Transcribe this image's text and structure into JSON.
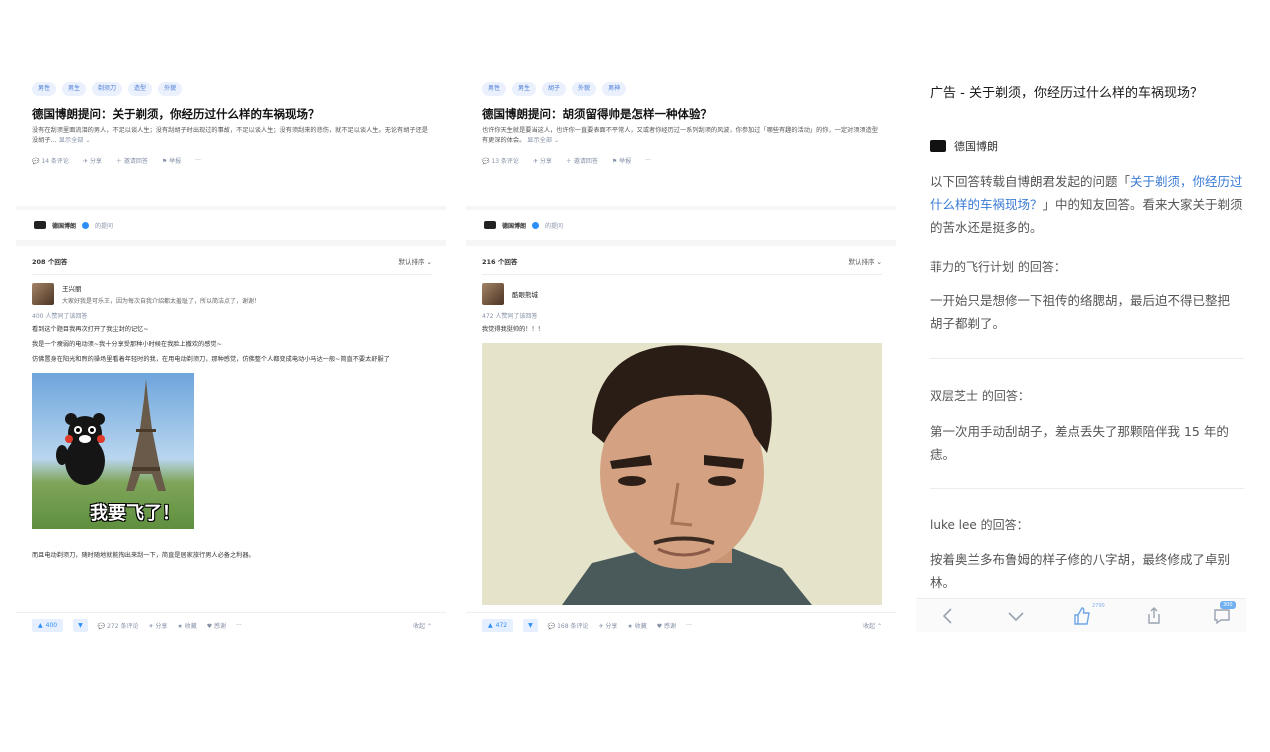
{
  "panel1": {
    "tags": [
      "男性",
      "男生",
      "剃须刀",
      "造型",
      "外貌"
    ],
    "question_title": "德国博朗提问：关于剃须，你经历过什么样的车祸现场？",
    "question_desc": "没有在刮须里面流泪的男人，不足以谈人生；没有刮胡子时出现过的事故，不足以谈人生；没有须刮来的悲伤，就不足以谈人生。无论有胡子还是没胡子…",
    "more_label": "显示全部 ⌄",
    "actions": {
      "comments": "14 条评论",
      "share": "分享",
      "invite": "邀请回答",
      "report": "举报",
      "more": "···"
    },
    "author": {
      "name": "德国博朗",
      "follow": "的提问"
    },
    "answers_count": "208 个回答",
    "sort_label": "默认排序 ⌄",
    "answer": {
      "user": "王兴丽",
      "bio": "大家好我是可乐王，因为每次自我介绍都太羞耻了，所以简洁点了，谢谢！",
      "likes": "400 人赞同了该回答",
      "para1": "看到这个题目我再次打开了我尘封的记忆~",
      "para2": "我是一个瘦弱的电动须~我十分享受那种小时候在我脸上撒欢的感觉~",
      "para3": "仿佛置身在阳光和煦的操场里看着年轻时的我，在用电动剃须刀，那种感觉，仿佛整个人都变成电动小马达一般~简直不要太舒服了",
      "meme_caption": "我要飞了！",
      "para4": "而且电动剃须刀，随时随地就能掏出来刮一下，简直是居家旅行男人必备之利器。"
    },
    "bottom": {
      "vote": "400",
      "comments": "272 条评论",
      "share": "分享",
      "collect": "收藏",
      "thanks": "感谢",
      "more": "···",
      "collapse": "收起 ⌃"
    }
  },
  "panel2": {
    "tags": [
      "男性",
      "男生",
      "胡子",
      "外貌",
      "男神"
    ],
    "question_title": "德国博朗提问：胡须留得帅是怎样一种体验？",
    "question_desc": "也许你天生就是要当这人，也许你一直要表面不平常人，又或者你经历过一系列刮须的风波，你参加过「哪些有趣的活动」的你，一定对须须造型有更深的体会。",
    "more_label": "显示全部 ⌄",
    "actions": {
      "comments": "13 条评论",
      "share": "分享",
      "invite": "邀请回答",
      "report": "举报",
      "more": "···"
    },
    "author": {
      "name": "德国博朗",
      "follow": "的提问"
    },
    "answers_count": "216 个回答",
    "sort_label": "默认排序 ⌄",
    "answer": {
      "user": "酷眼熊城",
      "likes": "472 人赞同了该回答",
      "para1": "我觉得我挺帅的！！！"
    },
    "bottom": {
      "vote": "472",
      "comments": "168 条评论",
      "share": "分享",
      "collect": "收藏",
      "thanks": "感谢",
      "more": "···",
      "collapse": "收起 ⌃"
    }
  },
  "panel3": {
    "ad_title": "广告 - 关于剃须，你经历过什么样的车祸现场？",
    "author": "德国博朗",
    "intro_before": "以下回答转载自博朗君发起的问题「",
    "intro_link": "关于剃须，你经历过什么样的车祸现场？",
    "intro_after": "」中的知友回答。看来大家关于剃须的苦水还是挺多的。",
    "responses": [
      {
        "label": "菲力的飞行计划 的回答：",
        "text": "一开始只是想修一下祖传的络腮胡，最后迫不得已整把胡子都剃了。"
      },
      {
        "label": "双层芝士 的回答：",
        "text": "第一次用手动刮胡子，差点丢失了那颗陪伴我 15 年的痣。"
      },
      {
        "label": "luke lee 的回答：",
        "text": "按着奥兰多布鲁姆的样子修的八字胡，最终修成了卓别林。"
      }
    ],
    "toolbar": {
      "like_count": "2790",
      "comment_count": "300"
    }
  },
  "colors": {
    "accent": "#2c8ef8",
    "tag_bg": "#eaf1fd",
    "link": "#3a7bd5"
  }
}
